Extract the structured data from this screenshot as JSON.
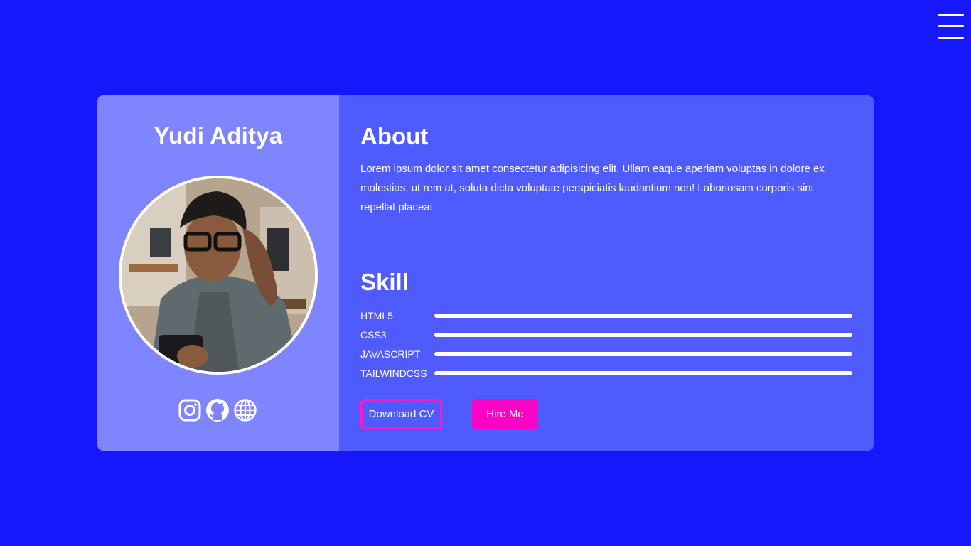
{
  "nav": {
    "menu_icon": "hamburger-menu-icon"
  },
  "profile": {
    "name": "Yudi Aditya",
    "photo_description": "avatar-photo",
    "socials": [
      {
        "icon": "instagram-icon"
      },
      {
        "icon": "github-icon"
      },
      {
        "icon": "globe-icon"
      }
    ]
  },
  "about": {
    "title": "About",
    "text": "Lorem ipsum dolor sit amet consectetur adipisicing elit. Ullam eaque aperiam voluptas in dolore ex molestias, ut rem at, soluta dicta voluptate perspiciatis laudantium non! Laboriosam corporis sint repellat placeat."
  },
  "skill": {
    "title": "Skill",
    "items": [
      {
        "label": "HTML5",
        "level": 1.0
      },
      {
        "label": "CSS3",
        "level": 1.0
      },
      {
        "label": "JAVASCRIPT",
        "level": 1.0
      },
      {
        "label": "TAILWINDCSS",
        "level": 1.0
      }
    ]
  },
  "actions": {
    "download_cv": "Download CV",
    "hire_me": "Hire Me"
  },
  "colors": {
    "background": "#1418fb",
    "card_left": "#7f85fe",
    "card_right": "#4f5bfd",
    "accent": "#ff00c6",
    "text": "#ffffff"
  }
}
